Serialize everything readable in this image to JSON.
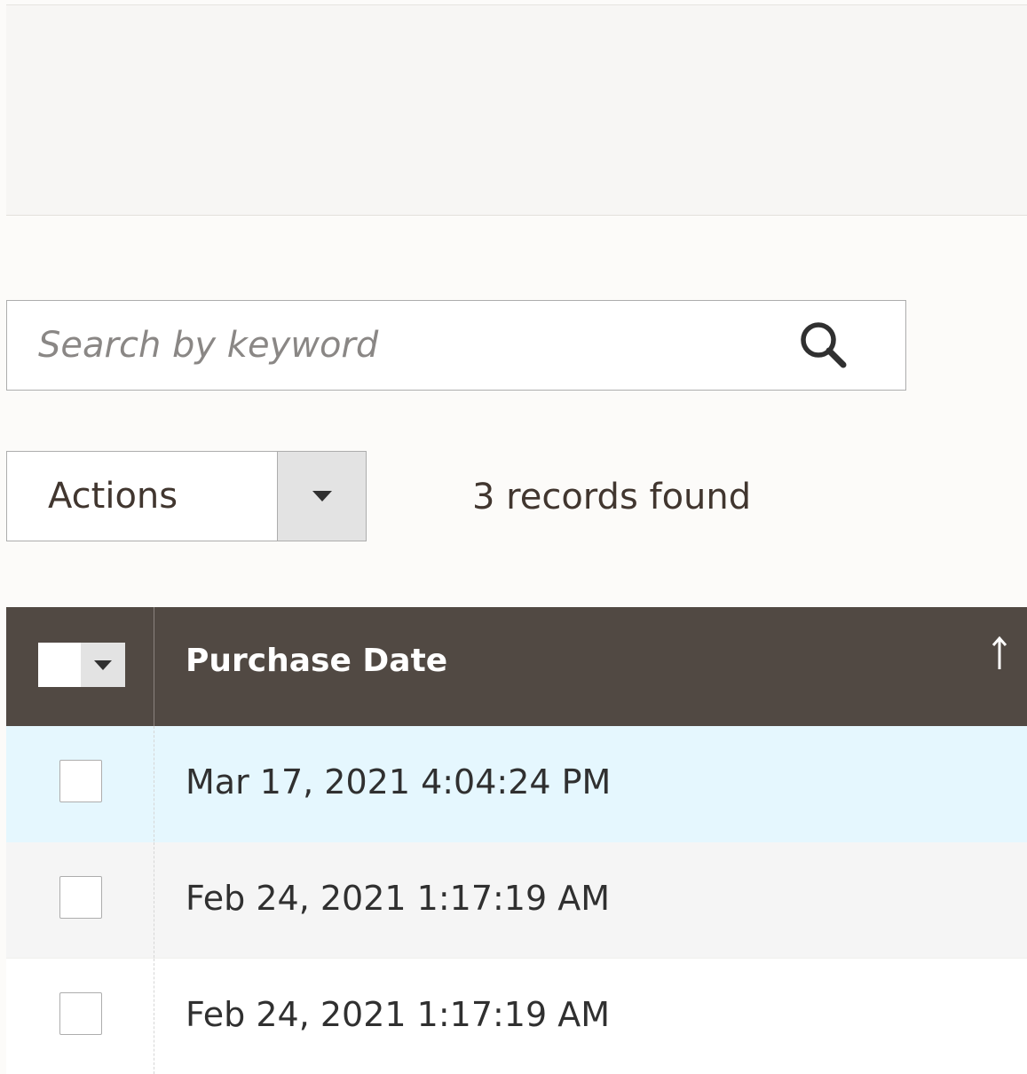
{
  "search": {
    "placeholder": "Search by keyword",
    "icon": "magnifier"
  },
  "actions": {
    "label": "Actions",
    "toggle_icon": "triangle-down"
  },
  "records": {
    "text": "3 records found",
    "count": 3
  },
  "grid": {
    "header": {
      "multiselect_icon": "triangle-down",
      "column_label": "Purchase Date",
      "sort_icon": "arrow-up",
      "sort_direction": "ascending"
    },
    "rows": [
      {
        "purchase_date": "Mar 17, 2021 4:04:24 PM",
        "checked": false
      },
      {
        "purchase_date": "Feb 24, 2021 1:17:19 AM",
        "checked": false
      },
      {
        "purchase_date": "Feb 24, 2021 1:17:19 AM",
        "checked": false
      }
    ]
  },
  "colors": {
    "header_bg": "#514943",
    "highlight_row": "#e5f7fe",
    "alt_row": "#f5f5f5",
    "panel_bg": "#f7f6f4"
  }
}
